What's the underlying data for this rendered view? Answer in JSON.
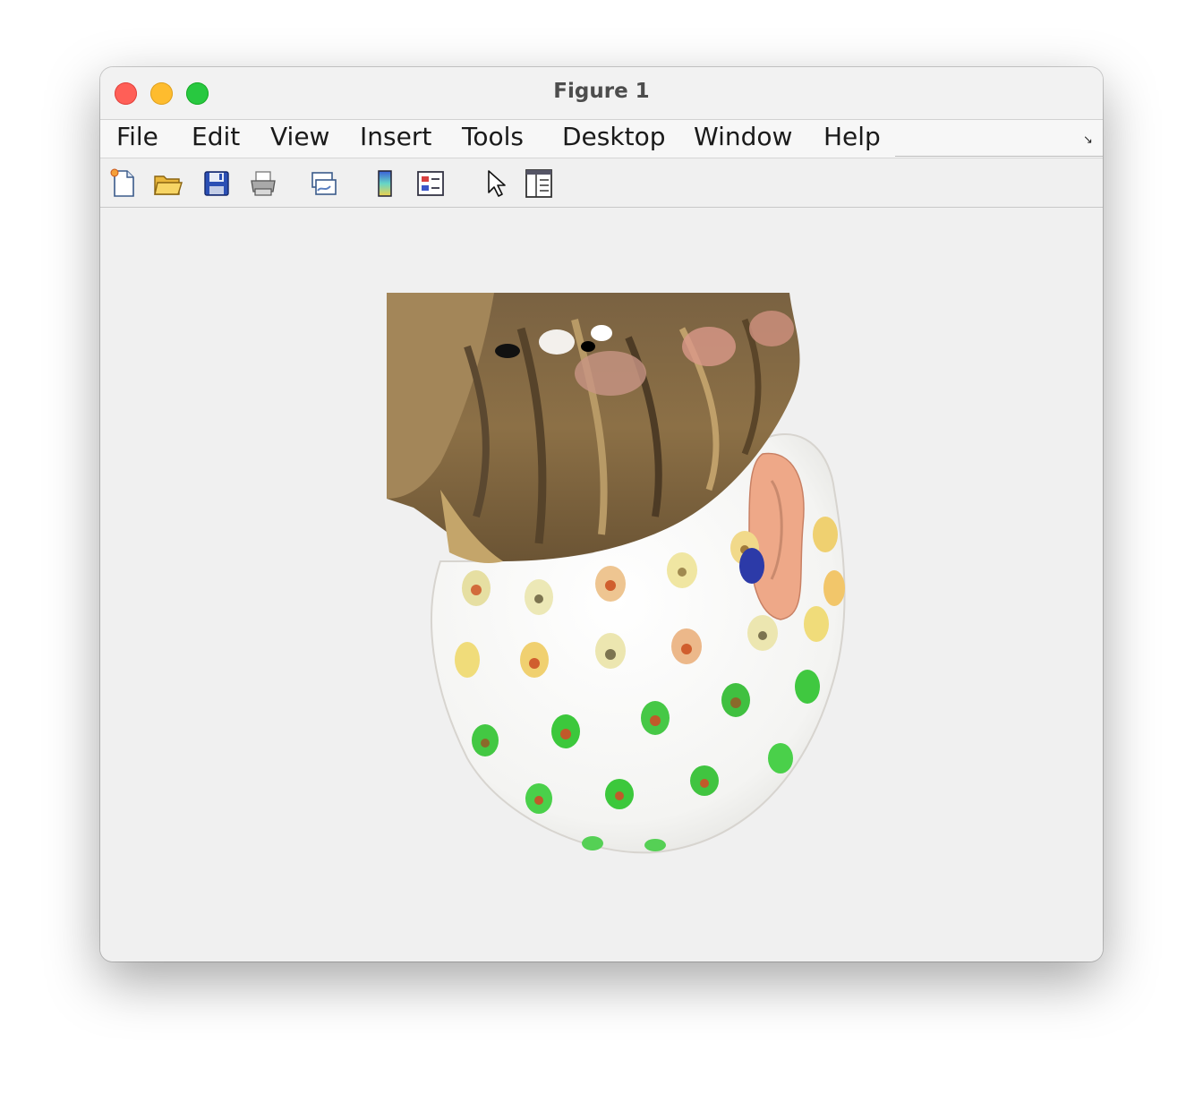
{
  "window": {
    "title": "Figure 1"
  },
  "menu": [
    {
      "id": "file",
      "label": "File"
    },
    {
      "id": "edit",
      "label": "Edit"
    },
    {
      "id": "view",
      "label": "View"
    },
    {
      "id": "insert",
      "label": "Insert"
    },
    {
      "id": "tools",
      "label": "Tools"
    },
    {
      "id": "desktop",
      "label": "Desktop"
    },
    {
      "id": "window",
      "label": "Window"
    },
    {
      "id": "help",
      "label": "Help"
    }
  ],
  "toolbar": [
    {
      "icon": "new-figure-icon"
    },
    {
      "icon": "open-file-icon"
    },
    {
      "icon": "save-icon"
    },
    {
      "icon": "print-icon"
    },
    {
      "icon": "link-plot-icon"
    },
    {
      "icon": "colorbar-icon"
    },
    {
      "icon": "legend-icon"
    },
    {
      "icon": "edit-plot-pointer-icon"
    },
    {
      "icon": "property-inspector-icon"
    }
  ],
  "colors": {
    "close": "#ff5f57",
    "minimize": "#febc2e",
    "maximize": "#28c840",
    "background": "#f0f0f0"
  }
}
